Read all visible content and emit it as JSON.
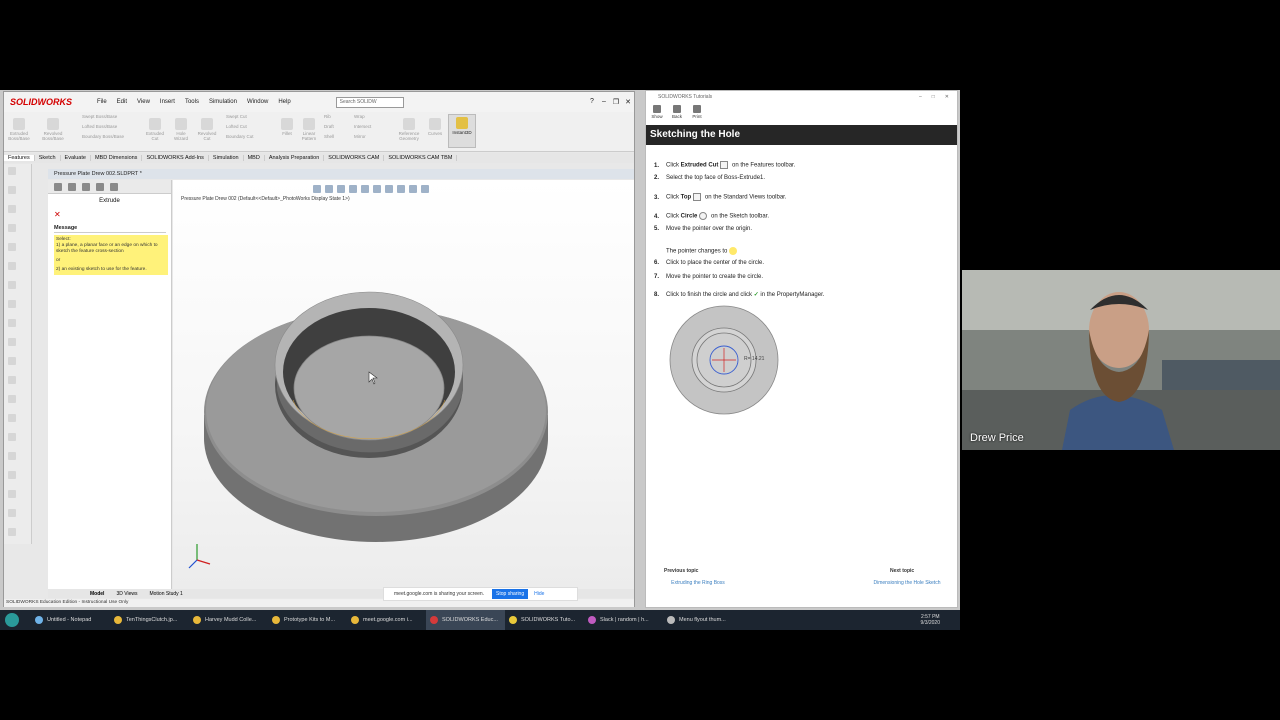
{
  "solidworks": {
    "logo": "SOLIDWORKS",
    "menu": [
      "File",
      "Edit",
      "View",
      "Insert",
      "Tools",
      "Simulation",
      "Window",
      "Help"
    ],
    "search_placeholder": "Search SOLIDW",
    "ribbon": [
      {
        "label": "Extruded Boss/Base"
      },
      {
        "label": "Revolved Boss/Base"
      },
      {
        "label": "Swept Boss/Base"
      },
      {
        "label": "Lofted Boss/Base"
      },
      {
        "label": "Boundary Boss/Base"
      },
      {
        "label": "Extruded Cut"
      },
      {
        "label": "Hole Wizard"
      },
      {
        "label": "Revolved Cut"
      },
      {
        "label": "Swept Cut"
      },
      {
        "label": "Lofted Cut"
      },
      {
        "label": "Boundary Cut"
      },
      {
        "label": "Fillet"
      },
      {
        "label": "Linear Pattern"
      },
      {
        "label": "Rib"
      },
      {
        "label": "Draft"
      },
      {
        "label": "Shell"
      },
      {
        "label": "Wrap"
      },
      {
        "label": "Intersect"
      },
      {
        "label": "Mirror"
      },
      {
        "label": "Reference Geometry"
      },
      {
        "label": "Curves"
      },
      {
        "label": "Instant3D"
      }
    ],
    "tabs": [
      "Features",
      "Sketch",
      "Evaluate",
      "MBD Dimensions",
      "SOLIDWORKS Add-Ins",
      "Simulation",
      "MBD",
      "Analysis Preparation",
      "SOLIDWORKS CAM",
      "SOLIDWORKS CAM TBM"
    ],
    "doc_title": "Pressure Plate Drew 002.SLDPRT *",
    "breadcrumb": "Pressure Plate Drew 002  (Default<<Default>_PhotoWorks Display State 1>)",
    "pm": {
      "title": "Extrude",
      "message_header": "Message",
      "select": "Select:",
      "line1": "1) a plane, a planar face or an edge on which to sketch the feature cross-section",
      "or": "or",
      "line2": "2) an existing sketch to use for the feature."
    },
    "bottom_tabs": [
      "Model",
      "3D Views",
      "Motion Study 1"
    ],
    "status": "SOLIDWORKS Education Edition - Instructional Use Only"
  },
  "tutorial": {
    "window_title": "SOLIDWORKS Tutorials",
    "toolbar": [
      "Show",
      "Back",
      "Print"
    ],
    "heading": "Sketching the Hole",
    "steps": [
      {
        "num": "1.",
        "pre": "Click ",
        "bold": "Extruded Cut",
        "post": " on the Features toolbar."
      },
      {
        "num": "2.",
        "pre": "Select the top face of Boss-Extrude1.",
        "bold": "",
        "post": ""
      },
      {
        "num": "3.",
        "pre": "Click ",
        "bold": "Top",
        "post": " on the Standard Views toolbar."
      },
      {
        "num": "4.",
        "pre": "Click ",
        "bold": "Circle",
        "post": " on the Sketch toolbar."
      },
      {
        "num": "5.",
        "pre": "Move the pointer over the origin.",
        "bold": "",
        "post": ""
      },
      {
        "num": "",
        "pre": "The pointer changes to",
        "bold": "",
        "post": ""
      },
      {
        "num": "6.",
        "pre": "Click to place the center of the circle.",
        "bold": "",
        "post": ""
      },
      {
        "num": "7.",
        "pre": "Move the pointer to create the circle.",
        "bold": "",
        "post": ""
      },
      {
        "num": "8.",
        "pre": "Click to finish the circle and click ",
        "bold": "",
        "post": " in the PropertyManager."
      }
    ],
    "figure_label": "R= 14.21",
    "prev_header": "Previous topic",
    "prev_link": "Extruding the Ring Boss",
    "next_header": "Next topic",
    "next_link": "Dimensioning the Hole Sketch"
  },
  "sharebar": {
    "text": "meet.google.com is sharing your screen.",
    "stop": "Stop sharing",
    "hide": "Hide"
  },
  "taskbar": {
    "items": [
      {
        "label": "Untitled - Notepad",
        "color": "#6fb3e8"
      },
      {
        "label": "TenThingsClutch.jp...",
        "color": "#e8b83a"
      },
      {
        "label": "Harvey Mudd Colle...",
        "color": "#e8b83a"
      },
      {
        "label": "Prototype Kits to M...",
        "color": "#e8b83a"
      },
      {
        "label": "meet.google.com i...",
        "color": "#e8b83a"
      },
      {
        "label": "SOLIDWORKS Educ...",
        "color": "#d53a3a"
      },
      {
        "label": "SOLIDWORKS Tuto...",
        "color": "#e8c93a"
      },
      {
        "label": "Slack | random | h...",
        "color": "#c05bc0"
      },
      {
        "label": "Menu flyout thum...",
        "color": "#bbbbbb"
      }
    ],
    "time": "2:57 PM",
    "date": "9/3/2020"
  },
  "webcam": {
    "name": "Drew Price"
  }
}
